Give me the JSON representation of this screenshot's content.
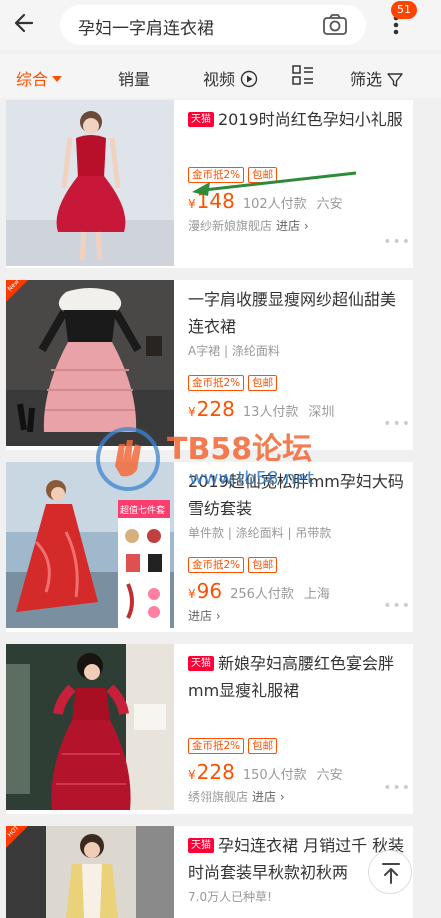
{
  "search": {
    "query": "孕妇一字肩连衣裙"
  },
  "header": {
    "more_badge": "51"
  },
  "sort_tabs": [
    {
      "label": "综合"
    },
    {
      "label": "销量"
    },
    {
      "label": "视频"
    },
    {
      "label": ""
    },
    {
      "label": "筛选"
    }
  ],
  "products": [
    {
      "badge": "天猫",
      "title": "2019时尚红色孕妇小礼服",
      "attrs": "",
      "tags": [
        "金币抵2%",
        "包邮"
      ],
      "price_symbol": "¥",
      "price": "148",
      "sales": "102人付款",
      "location": "六安",
      "shop": "漫纱新娘旗舰店",
      "enter": "进店 ›"
    },
    {
      "badge": "",
      "title": "一字肩收腰显瘦网纱超仙甜美连衣裙",
      "attrs": "A字裙 | 涤纶面料",
      "tags": [
        "金币抵2%",
        "包邮"
      ],
      "price_symbol": "¥",
      "price": "228",
      "sales": "13人付款",
      "location": "深圳",
      "shop": "",
      "enter": "",
      "corner": "New"
    },
    {
      "badge": "",
      "title": "2019超仙宽松胖mm孕妇大码雪纺套装",
      "attrs": "单件款 | 涤纶面料 | 吊带款",
      "tags": [
        "金币抵2%",
        "包邮"
      ],
      "price_symbol": "¥",
      "price": "96",
      "sales": "256人付款",
      "location": "上海",
      "shop": "",
      "enter": "进店 ›",
      "thumb_label": "超值七件套"
    },
    {
      "badge": "天猫",
      "title": "新娘孕妇高腰红色宴会胖mm显瘦礼服裙",
      "attrs": "",
      "tags": [
        "金币抵2%",
        "包邮"
      ],
      "price_symbol": "¥",
      "price": "228",
      "sales": "150人付款",
      "location": "六安",
      "shop": "绣翎旗舰店",
      "enter": "进店 ›"
    },
    {
      "badge": "天猫",
      "title": "孕妇连衣裙 月销过千 秋装时尚套装早秋款初秋两",
      "attrs": "7.0万人已种草!",
      "tags": [],
      "price_symbol": "",
      "price": "",
      "sales": "",
      "location": "",
      "shop": "",
      "enter": "",
      "corner": "HOT"
    }
  ],
  "watermark": {
    "title": "TB58论坛",
    "url": "www.tb58.net"
  },
  "colors": {
    "accent": "#ff5000",
    "tmall": "#ff0036"
  }
}
